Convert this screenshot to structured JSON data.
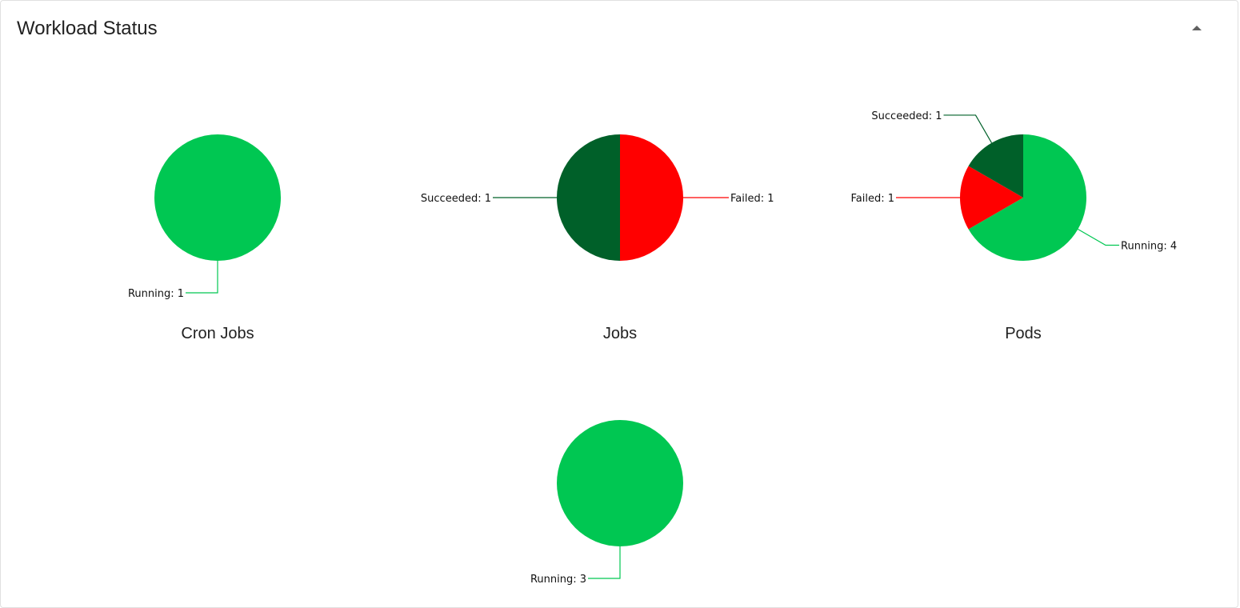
{
  "card": {
    "title": "Workload Status",
    "collapse_icon": "arrow-drop-up-icon"
  },
  "colors": {
    "Running": "#00c752",
    "Succeeded": "#006029",
    "Failed": "#ff0000"
  },
  "chart_data": [
    {
      "type": "pie",
      "title": "Cron Jobs",
      "slices": [
        {
          "label": "Running",
          "value": 1
        }
      ]
    },
    {
      "type": "pie",
      "title": "Jobs",
      "slices": [
        {
          "label": "Failed",
          "value": 1
        },
        {
          "label": "Succeeded",
          "value": 1
        }
      ]
    },
    {
      "type": "pie",
      "title": "Pods",
      "slices": [
        {
          "label": "Running",
          "value": 4
        },
        {
          "label": "Failed",
          "value": 1
        },
        {
          "label": "Succeeded",
          "value": 1
        }
      ]
    },
    {
      "type": "pie",
      "title": "",
      "slices": [
        {
          "label": "Running",
          "value": 3
        }
      ]
    }
  ]
}
